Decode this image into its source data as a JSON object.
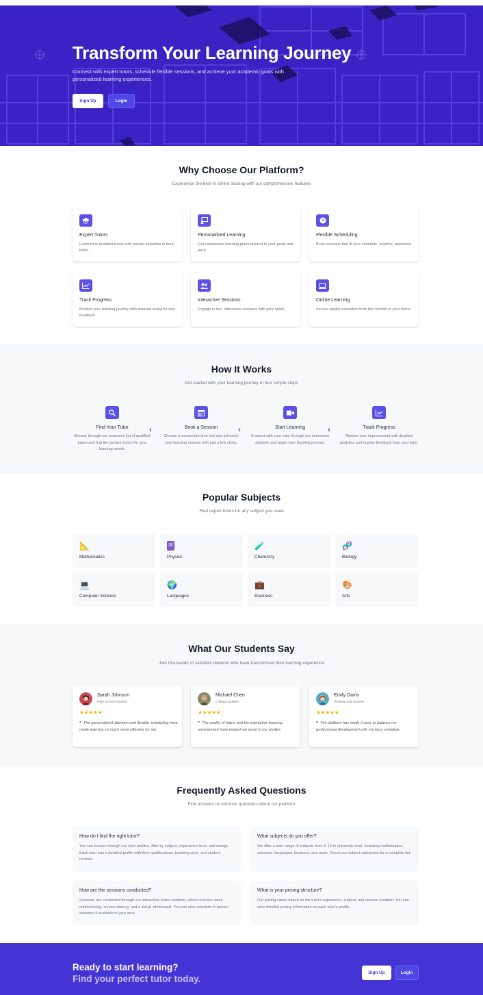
{
  "colors": {
    "primary": "#4f46e5",
    "hero_overlay": "#3a22c4",
    "star": "#f5b400",
    "soft_bg": "#f7f8fa"
  },
  "hero": {
    "title": "Transform Your Learning Journey",
    "subtitle": "Connect with expert tutors, schedule flexible sessions, and achieve your academic goals with personalized learning experiences.",
    "signup_label": "Sign Up",
    "login_label": "Login"
  },
  "why": {
    "title": "Why Choose Our Platform?",
    "subtitle": "Experience the best in online tutoring with our comprehensive features",
    "features": [
      {
        "icon": "graduation-cap-icon",
        "title": "Expert Tutors",
        "desc": "Learn from qualified tutors with proven expertise in their fields."
      },
      {
        "icon": "chalkboard-user-icon",
        "title": "Personalized Learning",
        "desc": "Get customized learning plans tailored to your goals and pace."
      },
      {
        "icon": "clock-icon",
        "title": "Flexible Scheduling",
        "desc": "Book sessions that fit your schedule, anytime, anywhere."
      },
      {
        "icon": "chart-line-icon",
        "title": "Track Progress",
        "desc": "Monitor your learning journey with detailed analytics and feedback."
      },
      {
        "icon": "users-icon",
        "title": "Interactive Sessions",
        "desc": "Engage in live, interactive sessions with your tutors."
      },
      {
        "icon": "laptop-icon",
        "title": "Online Learning",
        "desc": "Access quality education from the comfort of your home."
      }
    ]
  },
  "how": {
    "title": "How It Works",
    "subtitle": "Get started with your learning journey in four simple steps",
    "steps": [
      {
        "icon": "search-icon",
        "title": "Find Your Tutor",
        "desc": "Browse through our extensive list of qualified tutors and find the perfect match for your learning needs."
      },
      {
        "icon": "calendar-icon",
        "title": "Book a Session",
        "desc": "Choose a convenient time slot and schedule your learning session with just a few clicks."
      },
      {
        "icon": "video-icon",
        "title": "Start Learning",
        "desc": "Connect with your tutor through our interactive platform and begin your learning journey."
      },
      {
        "icon": "chart-line-icon",
        "title": "Track Progress",
        "desc": "Monitor your improvement with detailed analytics and regular feedback from your tutor."
      }
    ],
    "arrow": "‹"
  },
  "subjects": {
    "title": "Popular Subjects",
    "subtitle": "Find expert tutors for any subject you need",
    "items": [
      {
        "emoji": "📐",
        "name": "Mathematics"
      },
      {
        "emoji": "⚛",
        "name": "Physics"
      },
      {
        "emoji": "🧪",
        "name": "Chemistry"
      },
      {
        "emoji": "🧬",
        "name": "Biology"
      },
      {
        "emoji": "💻",
        "name": "Computer Science"
      },
      {
        "emoji": "🌍",
        "name": "Languages"
      },
      {
        "emoji": "💼",
        "name": "Business"
      },
      {
        "emoji": "🎨",
        "name": "Arts"
      }
    ]
  },
  "testimonials": {
    "title": "What Our Students Say",
    "subtitle": "Join thousands of satisfied students who have transformed their learning experience",
    "stars": "★★★★★",
    "quote_mark": "❝",
    "items": [
      {
        "name": "Sarah Johnson",
        "role": "High School Student",
        "rating": 5,
        "quote": "The personalized attention and flexible scheduling have made learning so much more effective for me."
      },
      {
        "name": "Michael Chen",
        "role": "College Student",
        "rating": 5,
        "quote": "The quality of tutors and the interactive learning environment have helped me excel in my studies."
      },
      {
        "name": "Emily Davis",
        "role": "Professional Learner",
        "rating": 5,
        "quote": "The platform has made it easy to balance my professional development with my busy schedule."
      }
    ]
  },
  "faq": {
    "title": "Frequently Asked Questions",
    "subtitle": "Find answers to common questions about our platform",
    "items": [
      {
        "q": "How do I find the right tutor?",
        "a": "You can browse through our tutor profiles, filter by subject, experience level, and ratings. Each tutor has a detailed profile with their qualifications, teaching style, and student reviews."
      },
      {
        "q": "What subjects do you offer?",
        "a": "We offer a wide range of subjects from K-12 to university level, including mathematics, sciences, languages, business, and more. Check our subject categories for a complete list."
      },
      {
        "q": "How are the sessions conducted?",
        "a": "Sessions are conducted through our interactive online platform, which includes video conferencing, screen sharing, and a virtual whiteboard. You can also schedule in-person sessions if available in your area."
      },
      {
        "q": "What is your pricing structure?",
        "a": "Our pricing varies based on the tutor's experience, subject, and session duration. You can view detailed pricing information on each tutor's profile."
      }
    ]
  },
  "cta": {
    "line1": "Ready to start learning?",
    "line2": "Find your perfect tutor today.",
    "signup_label": "Sign Up",
    "login_label": "Login"
  }
}
